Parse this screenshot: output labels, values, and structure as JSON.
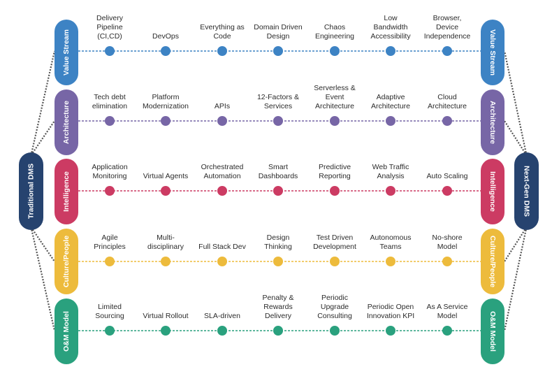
{
  "endpoints": {
    "left": {
      "label": "Traditional DMS",
      "color": "#26436f"
    },
    "right": {
      "label": "Next-Gen DMS",
      "color": "#26436f"
    }
  },
  "connector_color": "#555555",
  "rows": [
    {
      "id": "value-stream",
      "label": "Value Stream",
      "color": "#3d83c4",
      "items": [
        "Delivery\nPipeline\n(CI,CD)",
        "DevOps",
        "Everything as\nCode",
        "Domain Driven\nDesign",
        "Chaos\nEngineering",
        "Low\nBandwidth\nAccessibility",
        "Browser,\nDevice\nIndependence"
      ]
    },
    {
      "id": "architecture",
      "label": "Architecture",
      "color": "#7766a6",
      "items": [
        "Tech debt\nelimination",
        "Platform\nModernization",
        "APIs",
        "12-Factors &\nServices",
        "Serverless &\nEvent\nArchitecture",
        "Adaptive\nArchitecture",
        "Cloud\nArchitecture"
      ]
    },
    {
      "id": "intelligence",
      "label": "Intelligence",
      "color": "#cc3b63",
      "items": [
        "Application\nMonitoring",
        "Virtual Agents",
        "Orchestrated\nAutomation",
        "Smart\nDashboards",
        "Predictive\nReporting",
        "Web Traffic\nAnalysis",
        "Auto Scaling"
      ]
    },
    {
      "id": "culture-people",
      "label": "Culture/People",
      "color": "#edbb3c",
      "items": [
        "Agile\nPrinciples",
        "Multi-\ndisciplinary",
        "Full Stack Dev",
        "Design\nThinking",
        "Test Driven\nDevelopment",
        "Autonomous\nTeams",
        "No-shore\nModel"
      ]
    },
    {
      "id": "om-model",
      "label": "O&M Model",
      "color": "#2aa17e",
      "items": [
        "Limited\nSourcing",
        "Virtual Rollout",
        "SLA-driven",
        "Penalty &\nRewards\nDelivery",
        "Periodic\nUpgrade\nConsulting",
        "Periodic Open\nInnovation KPI",
        "As A Service\nModel"
      ]
    }
  ]
}
